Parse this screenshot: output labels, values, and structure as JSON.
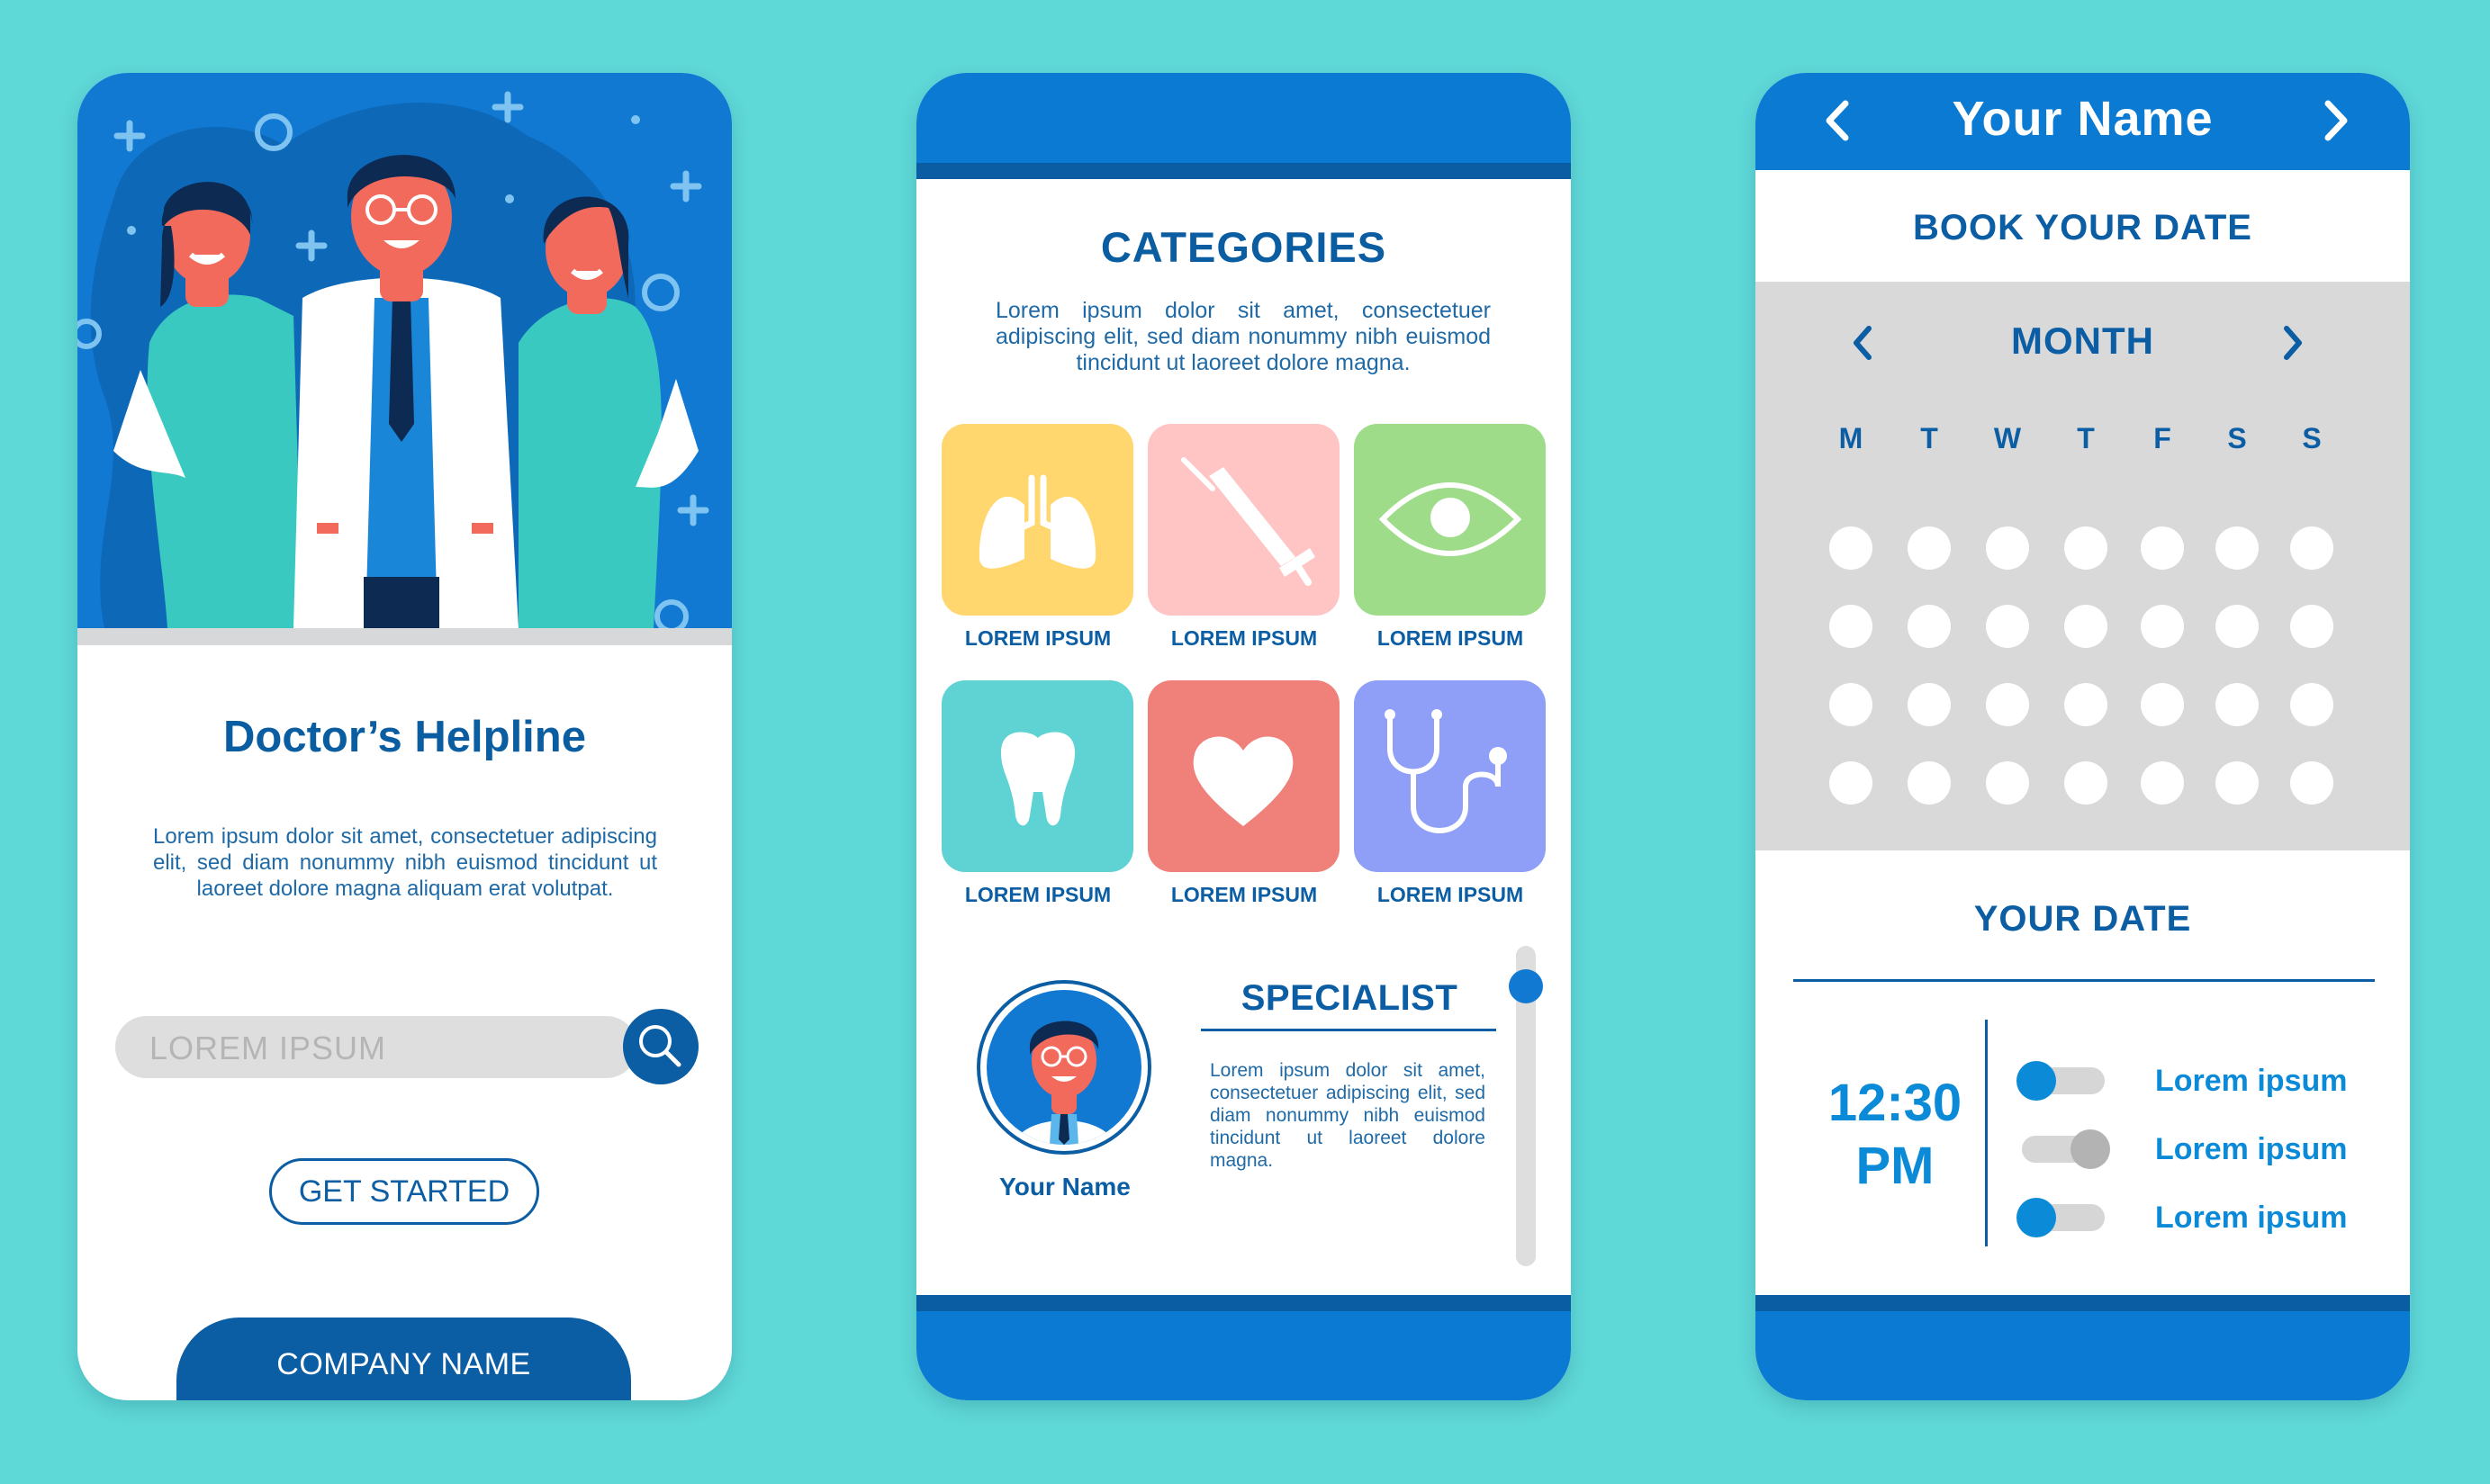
{
  "colors": {
    "background": "#5fd8d8",
    "primary": "#0a7ad2",
    "dark_blue": "#0b5da4",
    "calendar_bg": "#d9d9d9",
    "tile_lungs": "#ffd76e",
    "tile_syringe": "#ffc4c4",
    "tile_eye": "#9edc8a",
    "tile_tooth": "#5fd3d3",
    "tile_heart": "#f0807a",
    "tile_stethoscope": "#8f9ff8"
  },
  "screen1": {
    "title": "Doctor’s Helpline",
    "description": "Lorem ipsum dolor sit amet, consectetuer adipiscing elit, sed diam nonummy nibh euismod tincidunt ut laoreet dolore magna aliquam erat volutpat.",
    "search": {
      "placeholder": "LOREM IPSUM",
      "icon": "search-icon"
    },
    "cta_label": "GET STARTED",
    "footer_label": "COMPANY NAME"
  },
  "screen2": {
    "title": "CATEGORIES",
    "description": "Lorem ipsum dolor sit amet, consectetuer adipiscing elit, sed diam nonummy nibh euismod tincidunt ut laoreet dolore magna.",
    "categories": [
      {
        "label": "LOREM IPSUM",
        "icon": "lungs-icon"
      },
      {
        "label": "LOREM IPSUM",
        "icon": "syringe-icon"
      },
      {
        "label": "LOREM IPSUM",
        "icon": "eye-icon"
      },
      {
        "label": "LOREM IPSUM",
        "icon": "tooth-icon"
      },
      {
        "label": "LOREM IPSUM",
        "icon": "heart-icon"
      },
      {
        "label": "LOREM IPSUM",
        "icon": "stethoscope-icon"
      }
    ],
    "specialist": {
      "heading": "SPECIALIST",
      "name": "Your Name",
      "description": "Lorem ipsum dolor sit amet, consectetuer adipiscing elit, sed diam nonummy nibh euismod tincidunt ut laoreet dolore magna."
    }
  },
  "screen3": {
    "header_name": "Your Name",
    "book_heading": "BOOK YOUR DATE",
    "month_label": "MONTH",
    "weekdays": [
      "M",
      "T",
      "W",
      "T",
      "F",
      "S",
      "S"
    ],
    "your_date_heading": "YOUR DATE",
    "time_line1": "12:30",
    "time_line2": "PM",
    "options": [
      {
        "label": "Lorem ipsum",
        "on": true
      },
      {
        "label": "Lorem ipsum",
        "on": false
      },
      {
        "label": "Lorem ipsum",
        "on": true
      }
    ]
  }
}
